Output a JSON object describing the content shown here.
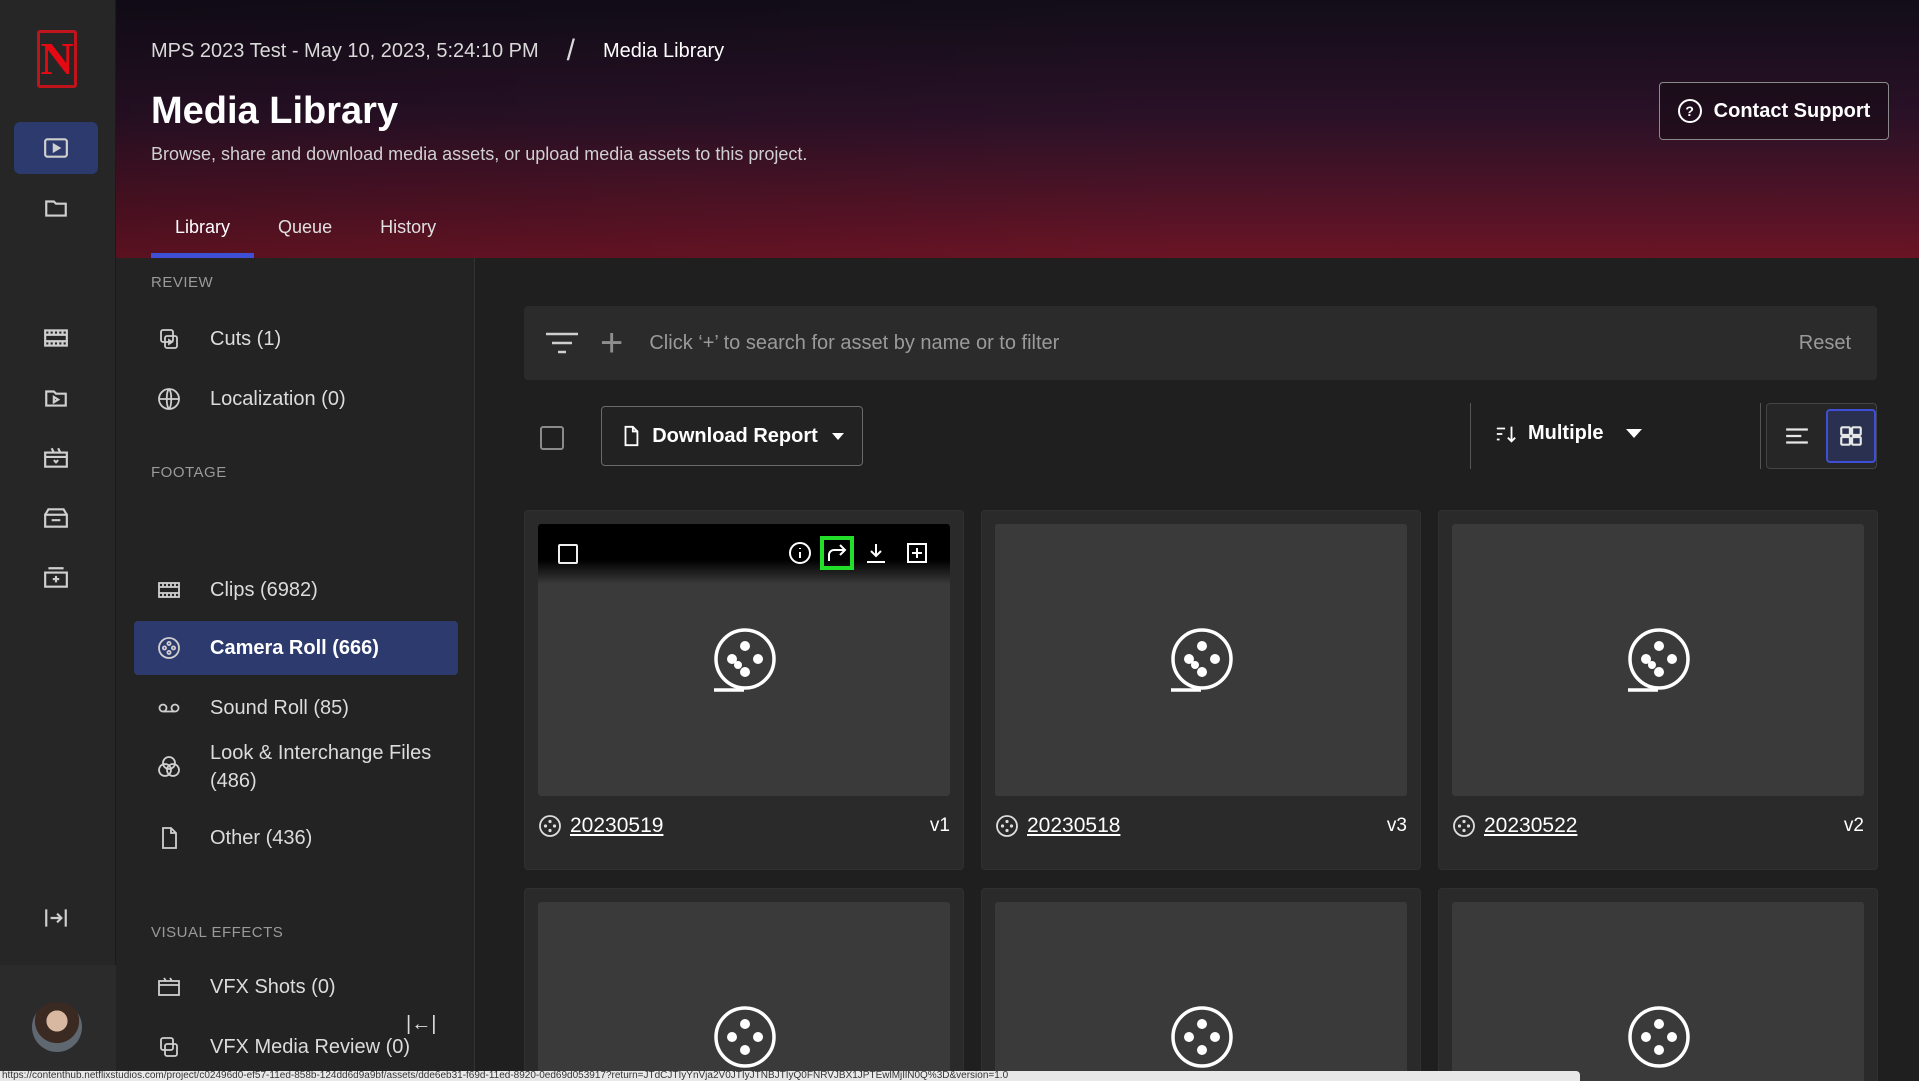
{
  "header": {
    "breadcrumb_project": "MPS 2023 Test - May 10, 2023, 5:24:10 PM",
    "breadcrumb_sep": "/",
    "breadcrumb_current": "Media Library",
    "title": "Media Library",
    "subtitle": "Browse, share and download media assets, or upload media assets to this project.",
    "support_label": "Contact Support",
    "tabs": [
      {
        "label": "Library",
        "active": true
      },
      {
        "label": "Queue",
        "active": false
      },
      {
        "label": "History",
        "active": false
      }
    ]
  },
  "brand": {
    "logo_letter": "N",
    "accent": "#3e4fd6",
    "logo_red": "#e50914"
  },
  "sidebar": {
    "sections": {
      "review": "REVIEW",
      "footage": "FOOTAGE",
      "vfx": "VISUAL EFFECTS"
    },
    "items": [
      {
        "label": "Cuts (1)",
        "icon": "cuts-icon"
      },
      {
        "label": "Localization (0)",
        "icon": "globe-icon"
      },
      {
        "label": "Clips (6982)",
        "icon": "film-strip-icon"
      },
      {
        "label": "Camera Roll (666)",
        "icon": "camera-roll-icon",
        "active": true
      },
      {
        "label": "Sound Roll (85)",
        "icon": "tape-icon"
      },
      {
        "label": "Look & Interchange Files (486)",
        "icon": "color-circles-icon"
      },
      {
        "label": "Other (436)",
        "icon": "file-icon"
      },
      {
        "label": "VFX Shots (0)",
        "icon": "vfx-shots-icon"
      },
      {
        "label": "VFX Media Review (0)",
        "icon": "vfx-review-icon"
      }
    ],
    "collapse_glyph": "|←|"
  },
  "search": {
    "placeholder": "Click ‘+’ to search for asset by name or to filter",
    "reset_label": "Reset"
  },
  "toolbar": {
    "download_label": "Download Report",
    "sort_label": "Multiple"
  },
  "cards": [
    {
      "name": "20230519",
      "version": "v1"
    },
    {
      "name": "20230518",
      "version": "v3"
    },
    {
      "name": "20230522",
      "version": "v2"
    }
  ],
  "statusbar": {
    "url": "https://contenthub.netflixstudios.com/project/c02496d0-ef57-11ed-858b-124dd6d9a9bf/assets/dde6eb31-f69d-11ed-8920-0ed69d053917?return=JTdCJTIyYnVja2V0JTIyJTNBJTIyQ0FNRVJBX1JPTEwlMjIlN0Q%3D&version=1.0"
  }
}
